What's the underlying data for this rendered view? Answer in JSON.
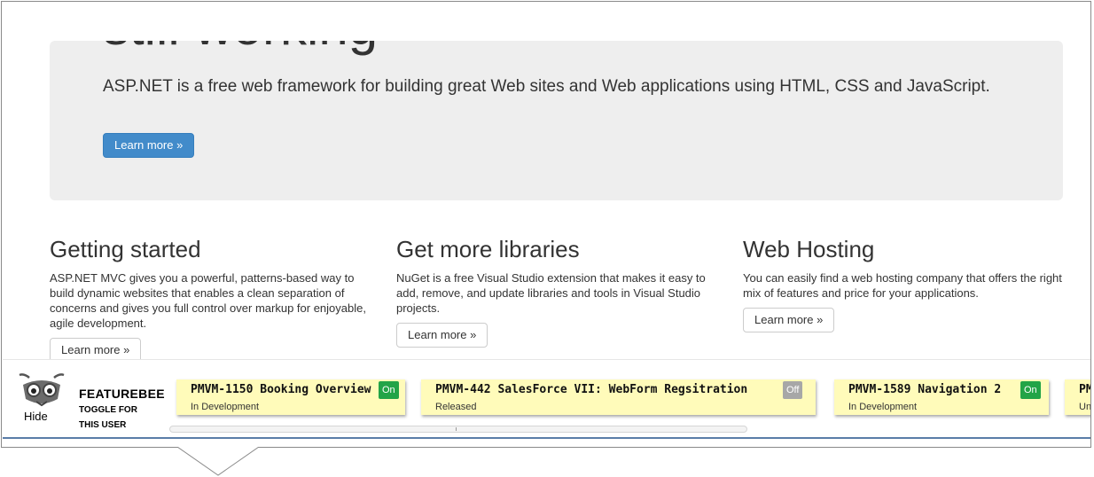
{
  "jumbotron": {
    "title": "still working",
    "lead": "ASP.NET is a free web framework for building great Web sites and Web applications using HTML, CSS and JavaScript.",
    "button_label": "Learn more »"
  },
  "columns": [
    {
      "heading": "Getting started",
      "text": "ASP.NET MVC gives you a powerful, patterns-based way to build dynamic websites that enables a clean separation of concerns and gives you full control over markup for enjoyable, agile development.",
      "button_label": "Learn more »"
    },
    {
      "heading": "Get more libraries",
      "text": "NuGet is a free Visual Studio extension that makes it easy to add, remove, and update libraries and tools in Visual Studio projects.",
      "button_label": "Learn more »"
    },
    {
      "heading": "Web Hosting",
      "text": "You can easily find a web hosting company that offers the right mix of features and price for your applications.",
      "button_label": "Learn more »"
    }
  ],
  "featurebee": {
    "icon": "bee-icon",
    "hide_label": "Hide",
    "title": "FEATUREBEE",
    "subtitle_line1": "TOGGLE FOR",
    "subtitle_line2": "THIS USER",
    "colors": {
      "on": "#22a447",
      "off": "#a7a7a7",
      "card": "#fffbba"
    },
    "features": [
      {
        "name": "PMVM-1150 Booking Overview",
        "status": "In Development",
        "toggle": "On"
      },
      {
        "name": "PMVM-442 SalesForce VII: WebForm Regsitration",
        "status": "Released",
        "toggle": "Off"
      },
      {
        "name": "PMVM-1589 Navigation 2",
        "status": "In Development",
        "toggle": "On"
      },
      {
        "name": "PM",
        "status": "Un",
        "toggle": ""
      }
    ]
  }
}
